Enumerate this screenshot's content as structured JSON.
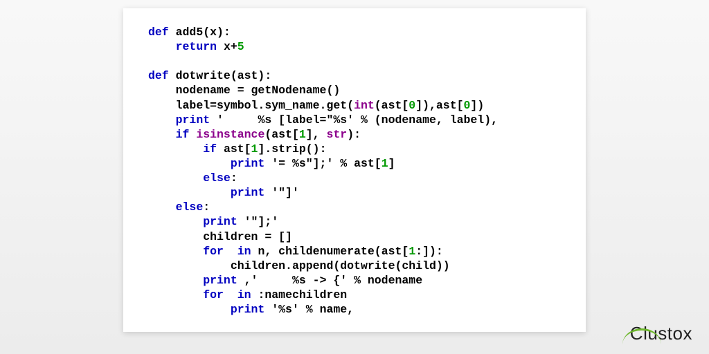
{
  "logo": {
    "text": "Clustox"
  },
  "code": {
    "lines": [
      {
        "indent": 0,
        "tokens": [
          {
            "t": "def ",
            "c": "kw"
          },
          {
            "t": "add5(x):",
            "c": "fn"
          }
        ]
      },
      {
        "indent": 1,
        "tokens": [
          {
            "t": "return",
            "c": "kw"
          },
          {
            "t": " ",
            "c": ""
          },
          {
            "t": "x+",
            "c": "fn"
          },
          {
            "t": "5",
            "c": "num"
          }
        ]
      },
      {
        "indent": 0,
        "tokens": []
      },
      {
        "indent": 0,
        "tokens": [
          {
            "t": "def ",
            "c": "kw"
          },
          {
            "t": "dotwrite(ast):",
            "c": "fn"
          }
        ]
      },
      {
        "indent": 1,
        "tokens": [
          {
            "t": "nodename = getNodename()",
            "c": "fn"
          }
        ]
      },
      {
        "indent": 1,
        "tokens": [
          {
            "t": "label=symbol.sym_name.get(",
            "c": "fn"
          },
          {
            "t": "int",
            "c": "bi"
          },
          {
            "t": "(ast[",
            "c": "fn"
          },
          {
            "t": "0",
            "c": "num"
          },
          {
            "t": "]),ast[",
            "c": "fn"
          },
          {
            "t": "0",
            "c": "num"
          },
          {
            "t": "])",
            "c": "fn"
          }
        ]
      },
      {
        "indent": 1,
        "tokens": [
          {
            "t": "print",
            "c": "kw"
          },
          {
            "t": " ",
            "c": ""
          },
          {
            "t": "'     %s [label=\"%s'",
            "c": "str"
          },
          {
            "t": " % (nodename, label),",
            "c": "fn"
          }
        ]
      },
      {
        "indent": 1,
        "tokens": [
          {
            "t": "if ",
            "c": "kw"
          },
          {
            "t": "isinstance",
            "c": "bi"
          },
          {
            "t": "(ast[",
            "c": "fn"
          },
          {
            "t": "1",
            "c": "num"
          },
          {
            "t": "], ",
            "c": "fn"
          },
          {
            "t": "str",
            "c": "bi"
          },
          {
            "t": "):",
            "c": "fn"
          }
        ]
      },
      {
        "indent": 2,
        "tokens": [
          {
            "t": "if ",
            "c": "kw"
          },
          {
            "t": "ast[",
            "c": "fn"
          },
          {
            "t": "1",
            "c": "num"
          },
          {
            "t": "].strip():",
            "c": "fn"
          }
        ]
      },
      {
        "indent": 3,
        "tokens": [
          {
            "t": "print",
            "c": "kw"
          },
          {
            "t": " ",
            "c": ""
          },
          {
            "t": "'= %s\"];'",
            "c": "str"
          },
          {
            "t": " % ast[",
            "c": "fn"
          },
          {
            "t": "1",
            "c": "num"
          },
          {
            "t": "]",
            "c": "fn"
          }
        ]
      },
      {
        "indent": 2,
        "tokens": [
          {
            "t": "else",
            "c": "kw"
          },
          {
            "t": ":",
            "c": "fn"
          }
        ]
      },
      {
        "indent": 3,
        "tokens": [
          {
            "t": "print",
            "c": "kw"
          },
          {
            "t": " ",
            "c": ""
          },
          {
            "t": "'\"]'",
            "c": "str"
          }
        ]
      },
      {
        "indent": 1,
        "tokens": [
          {
            "t": "else",
            "c": "kw"
          },
          {
            "t": ":",
            "c": "fn"
          }
        ]
      },
      {
        "indent": 2,
        "tokens": [
          {
            "t": "print",
            "c": "kw"
          },
          {
            "t": " ",
            "c": ""
          },
          {
            "t": "'\"];'",
            "c": "str"
          }
        ]
      },
      {
        "indent": 2,
        "tokens": [
          {
            "t": "children = []",
            "c": "fn"
          }
        ]
      },
      {
        "indent": 2,
        "tokens": [
          {
            "t": "for",
            "c": "kw"
          },
          {
            "t": "  ",
            "c": ""
          },
          {
            "t": "in",
            "c": "kw"
          },
          {
            "t": " ",
            "c": ""
          },
          {
            "t": "n, childenumerate(ast[",
            "c": "fn"
          },
          {
            "t": "1",
            "c": "num"
          },
          {
            "t": ":]):",
            "c": "fn"
          }
        ]
      },
      {
        "indent": 3,
        "tokens": [
          {
            "t": "children.append(dotwrite(child))",
            "c": "fn"
          }
        ]
      },
      {
        "indent": 2,
        "tokens": [
          {
            "t": "print",
            "c": "kw"
          },
          {
            "t": " ,",
            "c": "fn"
          },
          {
            "t": "'     %s -> {'",
            "c": "str"
          },
          {
            "t": " % nodename",
            "c": "fn"
          }
        ]
      },
      {
        "indent": 2,
        "tokens": [
          {
            "t": "for",
            "c": "kw"
          },
          {
            "t": "  ",
            "c": ""
          },
          {
            "t": "in",
            "c": "kw"
          },
          {
            "t": " ",
            "c": ""
          },
          {
            "t": ":namechildren",
            "c": "fn"
          }
        ]
      },
      {
        "indent": 3,
        "tokens": [
          {
            "t": "print",
            "c": "kw"
          },
          {
            "t": " ",
            "c": ""
          },
          {
            "t": "'%s'",
            "c": "str"
          },
          {
            "t": " % name,",
            "c": "fn"
          }
        ]
      }
    ]
  }
}
